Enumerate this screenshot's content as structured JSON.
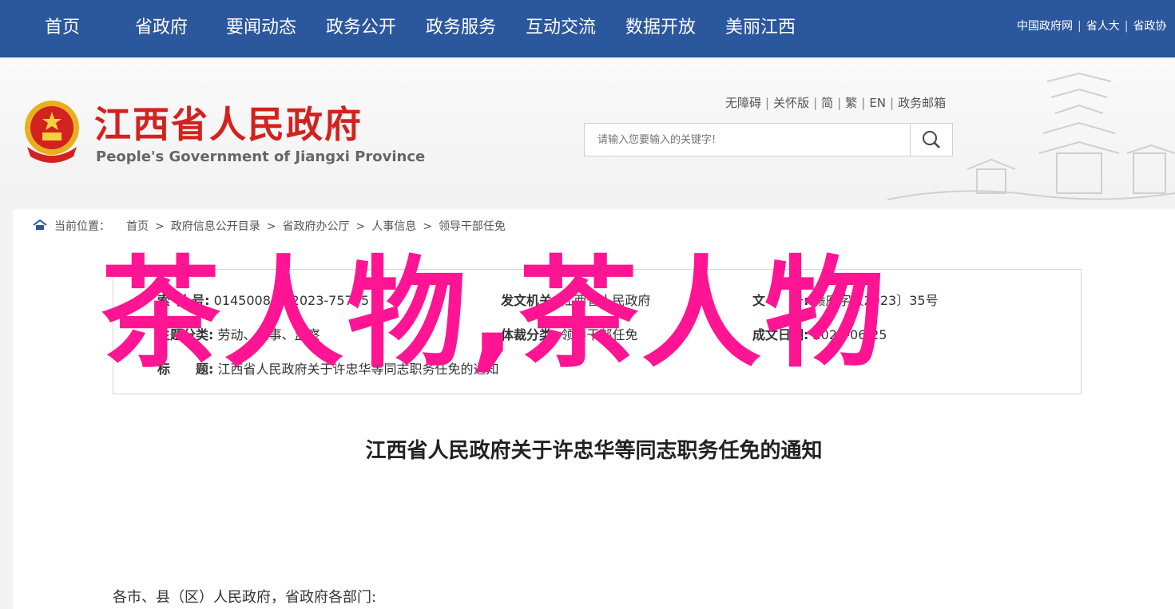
{
  "top_nav": {
    "items": [
      "首页",
      "省政府",
      "要闻动态",
      "政务公开",
      "政务服务",
      "互动交流",
      "数据开放",
      "美丽江西"
    ],
    "right_links": [
      "中国政府网",
      "省人大",
      "省政协"
    ]
  },
  "header": {
    "title": "江西省人民政府",
    "subtitle": "People's Government of Jiangxi Province",
    "tools": [
      "无障碍",
      "关怀版",
      "简",
      "繁",
      "EN",
      "政务邮箱"
    ],
    "search_placeholder": "请输入您要输入的关键字!"
  },
  "breadcrumb": {
    "label": "当前位置：",
    "items": [
      "首页",
      "政府信息公开目录",
      "省政府办公厅",
      "人事信息",
      "领导干部任免"
    ]
  },
  "meta": {
    "index_label": "索 引 号:",
    "index_value": "014500843/2023-75735",
    "issuer_label": "发文机关:",
    "issuer_value": "江西省人民政府",
    "docno_label": "文　　号:",
    "docno_value": "赣府字〔2023〕35号",
    "topic_label": "主题分类:",
    "topic_value": "劳动、人事、监察",
    "genre_label": "体裁分类:",
    "genre_value": "领导干部任免",
    "date_label": "成文日期:",
    "date_value": "2023-06-25",
    "title_label": "标　　题:",
    "title_value": "江西省人民政府关于许忠华等同志职务任免的通知"
  },
  "overlay_text": "茶人物,茶人物",
  "doc_title": "江西省人民政府关于许忠华等同志职务任免的通知",
  "salutation": "各市、县（区）人民政府，省政府各部门:",
  "colors": {
    "nav_bg": "#2b579d",
    "title_red": "#d3221e",
    "overlay_pink": "#ff1493"
  }
}
